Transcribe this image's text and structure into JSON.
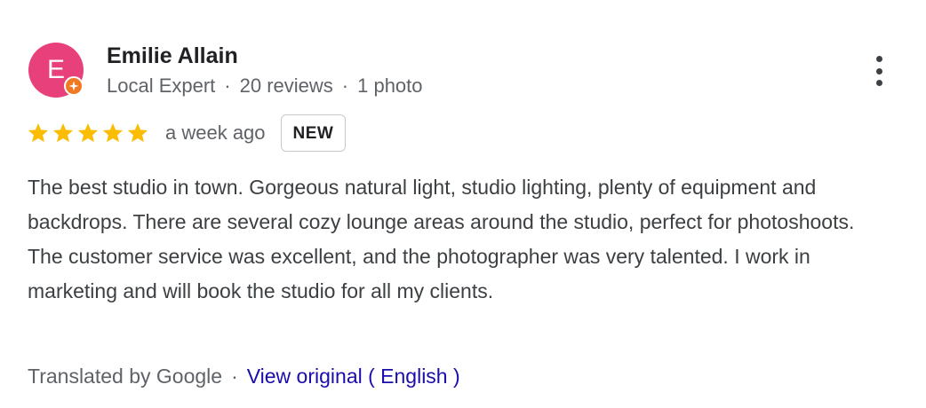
{
  "reviewer": {
    "avatar_letter": "E",
    "avatar_color": "#e8407a",
    "badge_color": "#f07a23",
    "badge_icon": "local-guide-sparkle-icon",
    "name": "Emilie Allain",
    "level": "Local Expert",
    "reviews_count": "20 reviews",
    "photos_count": "1 photo",
    "separator": "·"
  },
  "menu": {
    "icon": "more-vert-icon"
  },
  "rating": {
    "stars": 5,
    "max_stars": 5,
    "star_color": "#fbbc04",
    "time_ago": "a week ago",
    "new_label": "NEW"
  },
  "review": {
    "text": "The best studio in town. Gorgeous natural light, studio lighting, plenty of equipment and backdrops. There are several cozy lounge areas around the studio, perfect for photoshoots. The customer service was excellent, and the photographer was very talented. I work in marketing and will book the studio for all my clients."
  },
  "translation": {
    "note": "Translated by Google",
    "separator": "·",
    "view_original_label": "View original ( English )",
    "link_color": "#1a0dab"
  }
}
